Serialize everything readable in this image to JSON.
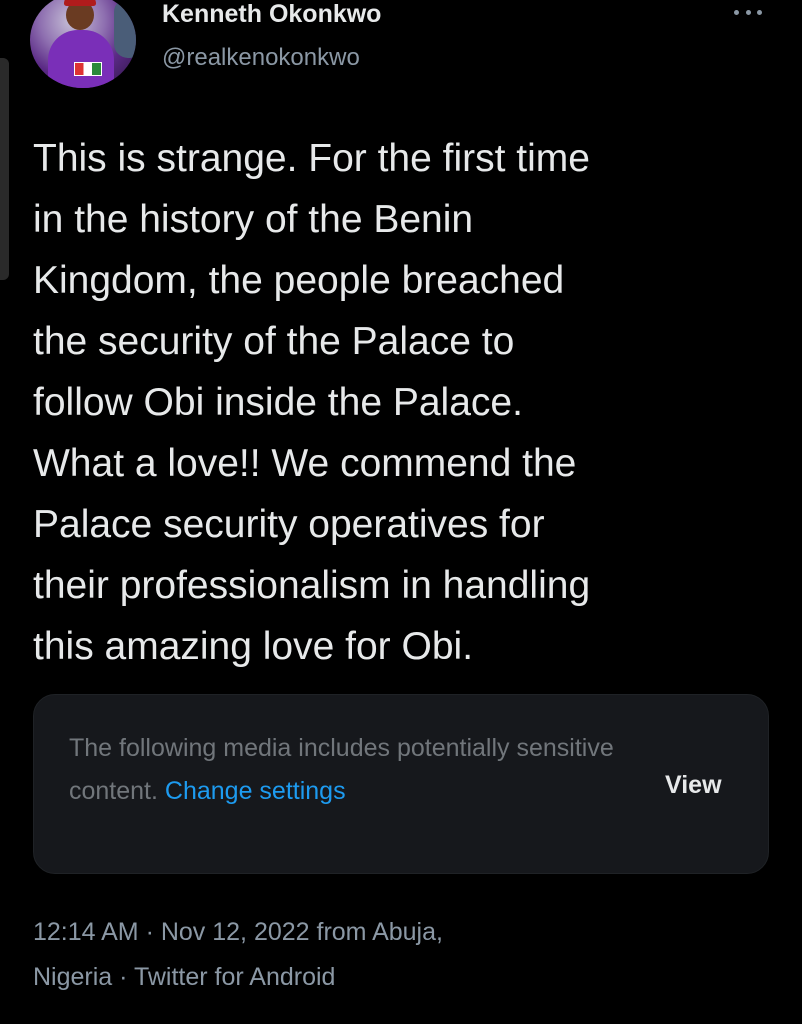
{
  "header": {
    "display_name": "Kenneth Okonkwo",
    "handle": "@realkenokonkwo",
    "avatar_icon": "profile-photo",
    "more_icon": "more-horizontal-icon"
  },
  "tweet": {
    "text": "This is strange. For the first time\nin the history of the Benin\nKingdom, the people breached\nthe security of the Palace to\nfollow Obi inside the Palace.\nWhat a love!! We commend the\nPalace security operatives for\ntheir professionalism in handling\nthis amazing love for Obi."
  },
  "media_warning": {
    "message": "The following media includes potentially sensitive content.",
    "link": "Change settings",
    "button": "View"
  },
  "meta": {
    "line1": "12:14 AM · Nov 12, 2022 from Abuja,",
    "line2": "Nigeria · Twitter for Android"
  },
  "colors": {
    "background": "#000000",
    "text": "#e7e9ea",
    "muted": "#8b98a5",
    "link": "#1d9bf0",
    "card": "#16181c"
  }
}
